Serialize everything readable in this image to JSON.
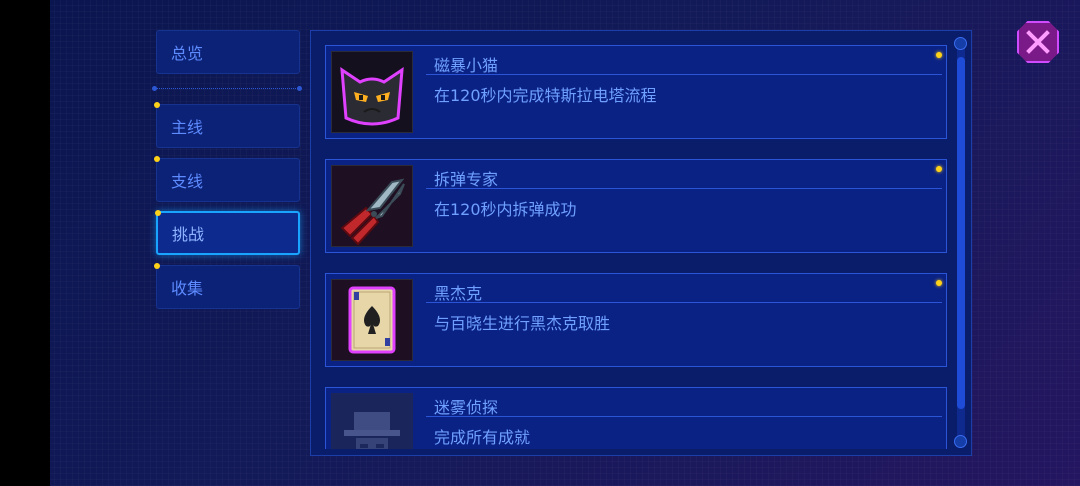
{
  "tabs": [
    {
      "label": "总览",
      "badge": false
    },
    {
      "label": "主线",
      "badge": true
    },
    {
      "label": "支线",
      "badge": true
    },
    {
      "label": "挑战",
      "badge": true,
      "active": true
    },
    {
      "label": "收集",
      "badge": true
    }
  ],
  "achievements": [
    {
      "title": "磁暴小猫",
      "desc": "在120秒内完成特斯拉电塔流程",
      "icon": "black-cat-icon",
      "badge": true
    },
    {
      "title": "拆弹专家",
      "desc": "在120秒内拆弹成功",
      "icon": "pliers-icon",
      "badge": true
    },
    {
      "title": "黑杰克",
      "desc": "与百晓生进行黑杰克取胜",
      "icon": "spade-card-icon",
      "badge": true
    },
    {
      "title": "迷雾侦探",
      "desc": "完成所有成就",
      "icon": "detective-hat-icon",
      "badge": false
    }
  ],
  "colors": {
    "accent": "#18a4ff",
    "badge": "#ffd21a",
    "close": "#d04bff"
  }
}
